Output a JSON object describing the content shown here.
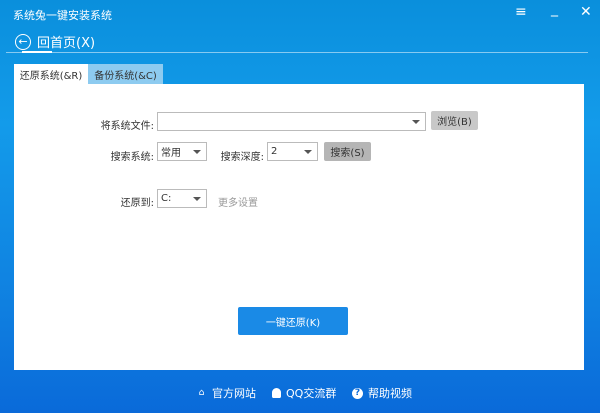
{
  "window": {
    "title": "系统兔一键安装系统",
    "menu_icon": "≡",
    "minimize_icon": "_",
    "close_icon": "✕"
  },
  "nav": {
    "back_label": "回首页(X)"
  },
  "tabs": [
    {
      "label": "还原系统(&R)",
      "active": true
    },
    {
      "label": "备份系统(&C)",
      "active": false
    }
  ],
  "form": {
    "file_label": "将系统文件:",
    "file_value": "",
    "browse_label": "浏览(B)",
    "search_system_label": "搜索系统:",
    "search_system_value": "常用",
    "search_depth_label": "搜索深度:",
    "search_depth_value": "2",
    "search_label": "搜索(S)",
    "restore_to_label": "还原到:",
    "restore_to_value": "C:",
    "more_settings": "更多设置"
  },
  "primary_button": "一键还原(K)",
  "footer": [
    {
      "label": "官方网站",
      "icon": "home-icon"
    },
    {
      "label": "QQ交流群",
      "icon": "qq-icon"
    },
    {
      "label": "帮助视频",
      "icon": "help-icon"
    }
  ]
}
